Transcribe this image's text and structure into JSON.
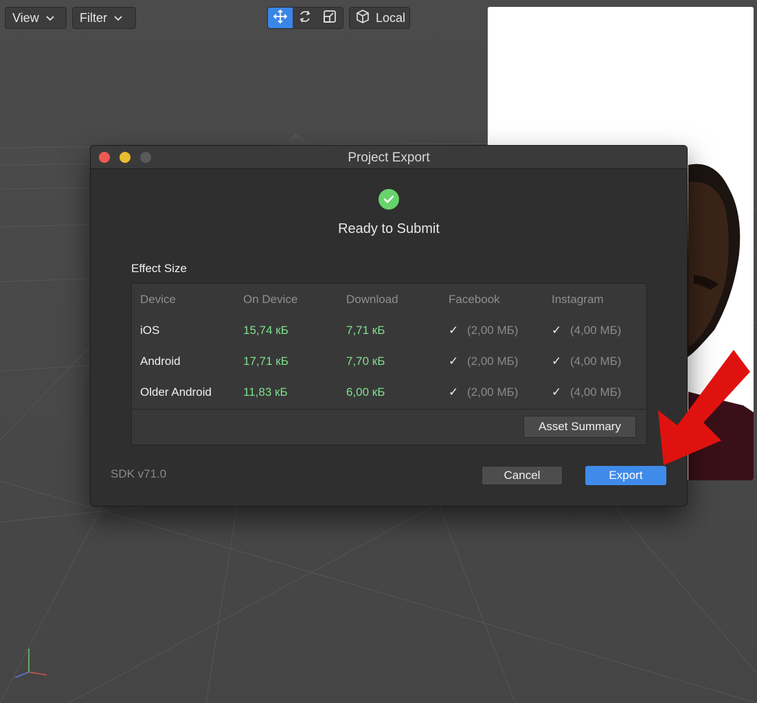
{
  "toolbar": {
    "view_label": "View",
    "filter_label": "Filter",
    "local_label": "Local"
  },
  "dialog": {
    "title": "Project Export",
    "status": "Ready to Submit",
    "effect_size_label": "Effect Size",
    "columns": [
      "Device",
      "On Device",
      "Download",
      "Facebook",
      "Instagram"
    ],
    "rows": [
      {
        "device": "iOS",
        "on_device": "15,74 кБ",
        "download": "7,71 кБ",
        "facebook_check": "✓",
        "facebook_limit": "(2,00 МБ)",
        "instagram_check": "✓",
        "instagram_limit": "(4,00 МБ)"
      },
      {
        "device": "Android",
        "on_device": "17,71 кБ",
        "download": "7,70 кБ",
        "facebook_check": "✓",
        "facebook_limit": "(2,00 МБ)",
        "instagram_check": "✓",
        "instagram_limit": "(4,00 МБ)"
      },
      {
        "device": "Older Android",
        "on_device": "11,83 кБ",
        "download": "6,00 кБ",
        "facebook_check": "✓",
        "facebook_limit": "(2,00 МБ)",
        "instagram_check": "✓",
        "instagram_limit": "(4,00 МБ)"
      }
    ],
    "asset_summary_label": "Asset Summary",
    "sdk_version": "SDK v71.0",
    "cancel_label": "Cancel",
    "export_label": "Export"
  },
  "colors": {
    "accent": "#3f8bea",
    "success": "#67d36b",
    "size_text": "#7fe08c",
    "annotation_arrow": "#e0120f"
  },
  "icons": [
    "chevron-down-icon",
    "move-icon",
    "rotate-icon",
    "scale-icon",
    "cube-icon",
    "checkmark-icon",
    "arrow-annotation"
  ]
}
